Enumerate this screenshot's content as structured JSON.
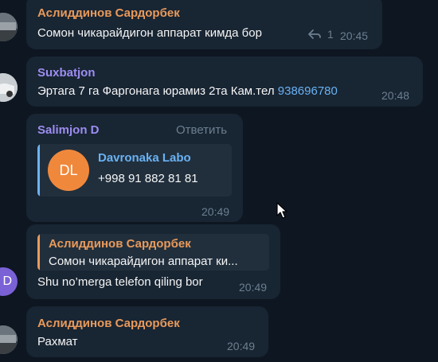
{
  "colors": {
    "background": "#0e1621",
    "bubble": "#182533",
    "name_orange": "#e99a5b",
    "name_purple": "#9d8df1",
    "link_blue": "#6ab2f2",
    "meta_gray": "#6d7f8f",
    "contact_avatar": "#f0883c"
  },
  "messages": [
    {
      "sender": "Аслиддинов Сардорбек",
      "text": "Сомон чикарайдигон аппарат кимда бор",
      "reply_count": "1",
      "time": "20:45"
    },
    {
      "sender": "Suxbatjon",
      "text": "Эртага 7 га Фаргонага юрамиз 2та Кам.тел ",
      "link": "938696780",
      "time": "20:48"
    },
    {
      "sender": "Salimjon D",
      "reply_action": "Ответить",
      "contact": {
        "initials": "DL",
        "name": "Davronaka Labo",
        "phone": "+998 91 882 81 81"
      },
      "time": "20:49"
    },
    {
      "avatar_initial": "D",
      "quote_sender": "Аслиддинов Сардорбек",
      "quote_text": "Сомон чикарайдигон аппарат ки...",
      "text": "Shu no’merga telefon qiling bor",
      "time": "20:49"
    },
    {
      "sender": "Аслиддинов Сардорбек",
      "text": "Рахмат",
      "time": "20:49"
    }
  ]
}
